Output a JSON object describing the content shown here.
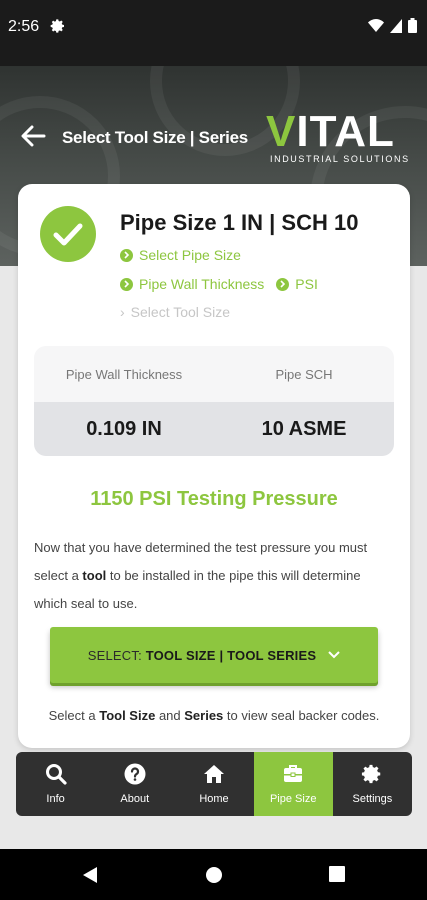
{
  "status_bar": {
    "time": "2:56"
  },
  "header": {
    "title": "Select Tool Size | Series",
    "logo_main": "VITAL",
    "logo_sub": "INDUSTRIAL SOLUTIONS"
  },
  "card": {
    "heading": "Pipe Size 1 IN | SCH 10",
    "steps": [
      {
        "label": "Select Pipe Size"
      },
      {
        "label": "Pipe Wall Thickness"
      },
      {
        "label": "PSI"
      },
      {
        "label": "Select Tool Size"
      }
    ],
    "table": {
      "col1_header": "Pipe Wall Thickness",
      "col2_header": "Pipe SCH",
      "col1_value": "0.109 IN",
      "col2_value": "10 ASME"
    },
    "pressure": "1150 PSI Testing Pressure",
    "desc_part1": "Now that you have determined the test pressure you must select a ",
    "desc_bold": "tool",
    "desc_part2": " to be installed in the pipe this will determine which seal to use.",
    "select_prefix": "SELECT: ",
    "select_bold": "TOOL SIZE | TOOL SERIES",
    "hint_part1": "Select a ",
    "hint_bold1": "Tool Size",
    "hint_part2": " and ",
    "hint_bold2": "Series",
    "hint_part3": " to view seal backer codes."
  },
  "nav": {
    "items": [
      {
        "label": "Info",
        "icon": "search-icon"
      },
      {
        "label": "About",
        "icon": "question-icon"
      },
      {
        "label": "Home",
        "icon": "home-icon"
      },
      {
        "label": "Pipe Size",
        "icon": "toolbox-icon"
      },
      {
        "label": "Settings",
        "icon": "gear-icon"
      }
    ],
    "active": "Pipe Size"
  },
  "colors": {
    "accent": "#8dc63f",
    "nav_bg": "#303030",
    "status_bg": "#1b1b1b"
  }
}
